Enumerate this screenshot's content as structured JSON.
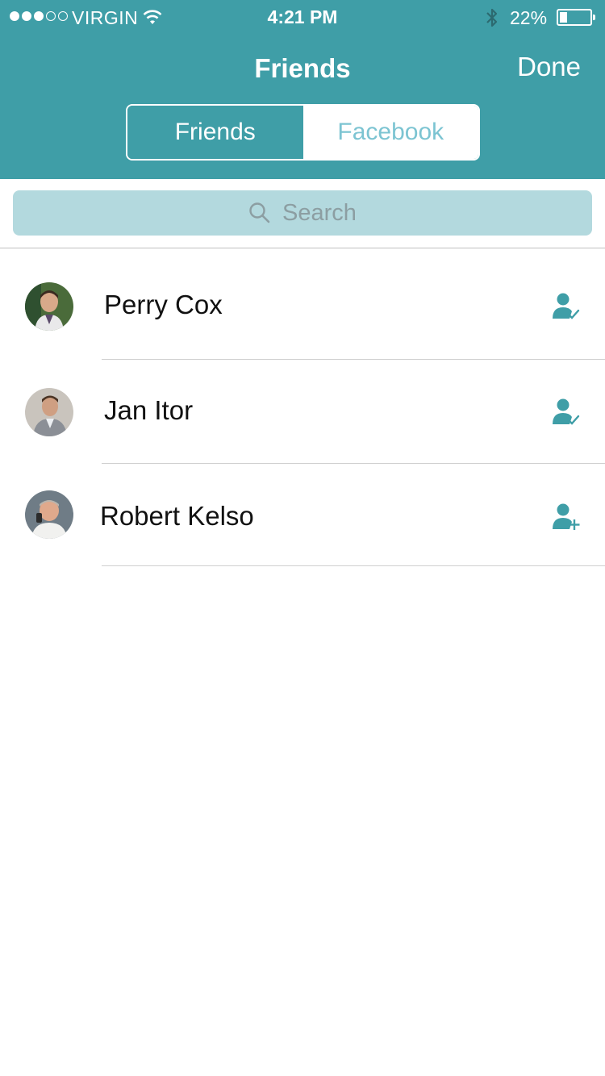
{
  "status_bar": {
    "carrier": "VIRGIN",
    "time": "4:21 PM",
    "battery": "22%",
    "signal_bars_filled": 3,
    "signal_bars_total": 5
  },
  "nav": {
    "title": "Friends",
    "done_label": "Done"
  },
  "segments": {
    "friends": "Friends",
    "facebook": "Facebook",
    "selected": "Friends"
  },
  "search": {
    "placeholder": "Search"
  },
  "friends": [
    {
      "name": "Perry Cox",
      "action_icon": "user-check-icon"
    },
    {
      "name": "Jan Itor",
      "action_icon": "user-check-icon"
    },
    {
      "name": "Robert Kelso",
      "action_icon": "user-add-icon"
    }
  ],
  "colors": {
    "header": "#3f9ea7",
    "search_field": "#b3d9de",
    "icon_accent": "#3f9ea7",
    "inactive_segment_text": "#7cc4d2"
  }
}
